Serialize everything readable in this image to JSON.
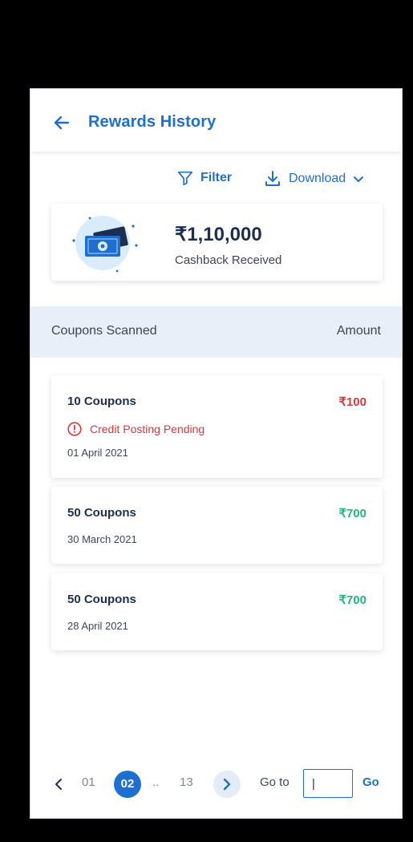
{
  "header": {
    "title": "Rewards History"
  },
  "toolbar": {
    "filter_label": "Filter",
    "download_label": "Download"
  },
  "summary": {
    "amount": "₹1,10,000",
    "label": "Cashback Received"
  },
  "table": {
    "col_left": "Coupons Scanned",
    "col_right": "Amount",
    "rows": [
      {
        "title": "10 Coupons",
        "amount": "₹100",
        "status": "Credit Posting Pending",
        "date": "01 April 2021"
      },
      {
        "title": "50 Coupons",
        "amount": "₹700",
        "date": "30 March 2021"
      },
      {
        "title": "50 Coupons",
        "amount": "₹700",
        "date": "28 April 2021"
      }
    ]
  },
  "pagination": {
    "first": "01",
    "current": "02",
    "ellipsis": "..",
    "last": "13",
    "goto_label": "Go to",
    "goto_value": "|",
    "go_label": "Go"
  },
  "colors": {
    "primary": "#1f6fd1",
    "pending": "#e0353b",
    "credited": "#1fb87a",
    "heading": "#1c2e52"
  }
}
